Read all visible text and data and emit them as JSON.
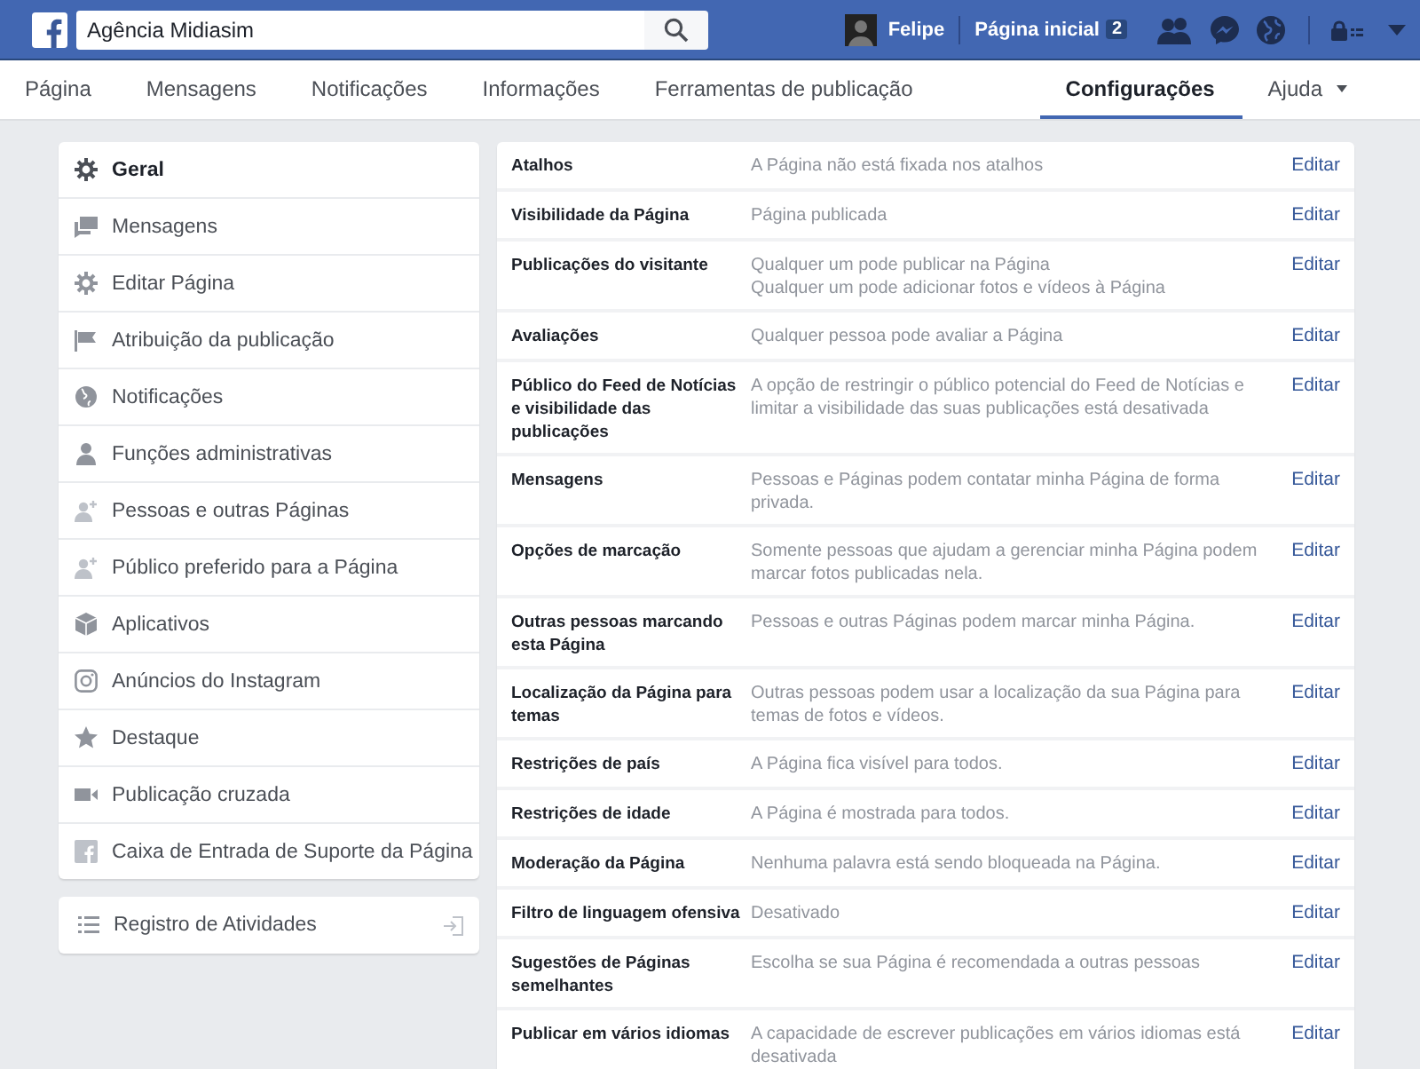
{
  "top_bar": {
    "search": {
      "value": "Agência Midiasim"
    },
    "user_name": "Felipe",
    "home_link": "Página inicial",
    "home_badge": "2"
  },
  "page_tabs": [
    {
      "label": "Página",
      "selected": false
    },
    {
      "label": "Mensagens",
      "selected": false
    },
    {
      "label": "Notificações",
      "selected": false
    },
    {
      "label": "Informações",
      "selected": false
    },
    {
      "label": "Ferramentas de publicação",
      "selected": false
    },
    {
      "label": "Configurações",
      "selected": true
    },
    {
      "label": "Ajuda",
      "selected": false,
      "dropdown": true
    }
  ],
  "sidebar": {
    "items": [
      {
        "label": "Geral",
        "selected": true
      },
      {
        "label": "Mensagens",
        "selected": false
      },
      {
        "label": "Editar Página",
        "selected": false
      },
      {
        "label": "Atribuição da publicação",
        "selected": false
      },
      {
        "label": "Notificações",
        "selected": false
      },
      {
        "label": "Funções administrativas",
        "selected": false
      },
      {
        "label": "Pessoas e outras Páginas",
        "selected": false
      },
      {
        "label": "Público preferido para a Página",
        "selected": false
      },
      {
        "label": "Aplicativos",
        "selected": false
      },
      {
        "label": "Anúncios do Instagram",
        "selected": false
      },
      {
        "label": "Destaque",
        "selected": false
      },
      {
        "label": "Publicação cruzada",
        "selected": false
      },
      {
        "label": "Caixa de Entrada de Suporte da Página",
        "selected": false
      }
    ],
    "activity_log": "Registro de Atividades"
  },
  "settings": [
    {
      "name": "Atalhos",
      "lines": [
        "A Página não está fixada nos atalhos"
      ],
      "action": "Editar"
    },
    {
      "name": "Visibilidade da Página",
      "lines": [
        "Página publicada"
      ],
      "action": "Editar"
    },
    {
      "name": "Publicações do visitante",
      "lines": [
        "Qualquer um pode publicar na Página",
        "Qualquer um pode adicionar fotos e vídeos à Página"
      ],
      "action": "Editar"
    },
    {
      "name": "Avaliações",
      "lines": [
        "Qualquer pessoa pode avaliar a Página"
      ],
      "action": "Editar"
    },
    {
      "name": "Público do Feed de Notícias e visibilidade das publicações",
      "lines": [
        "A opção de restringir o público potencial do Feed de Notícias e limitar a visibilidade das suas publicações está desativada"
      ],
      "action": "Editar"
    },
    {
      "name": "Mensagens",
      "lines": [
        "Pessoas e Páginas podem contatar minha Página de forma privada."
      ],
      "action": "Editar"
    },
    {
      "name": "Opções de marcação",
      "lines": [
        "Somente pessoas que ajudam a gerenciar minha Página podem marcar fotos publicadas nela."
      ],
      "action": "Editar"
    },
    {
      "name": "Outras pessoas marcando esta Página",
      "lines": [
        "Pessoas e outras Páginas podem marcar minha Página."
      ],
      "action": "Editar"
    },
    {
      "name": "Localização da Página para temas",
      "lines": [
        "Outras pessoas podem usar a localização da sua Página para temas de fotos e vídeos."
      ],
      "action": "Editar"
    },
    {
      "name": "Restrições de país",
      "lines": [
        "A Página fica visível para todos."
      ],
      "action": "Editar"
    },
    {
      "name": "Restrições de idade",
      "lines": [
        "A Página é mostrada para todos."
      ],
      "action": "Editar"
    },
    {
      "name": "Moderação da Página",
      "lines": [
        "Nenhuma palavra está sendo bloqueada na Página."
      ],
      "action": "Editar"
    },
    {
      "name": "Filtro de linguagem ofensiva",
      "lines": [
        "Desativado"
      ],
      "action": "Editar"
    },
    {
      "name": "Sugestões de Páginas semelhantes",
      "lines": [
        "Escolha se sua Página é recomendada a outras pessoas"
      ],
      "action": "Editar"
    },
    {
      "name": "Publicar em vários idiomas",
      "lines": [
        "A capacidade de escrever publicações em vários idiomas está desativada"
      ],
      "action": "Editar"
    }
  ]
}
